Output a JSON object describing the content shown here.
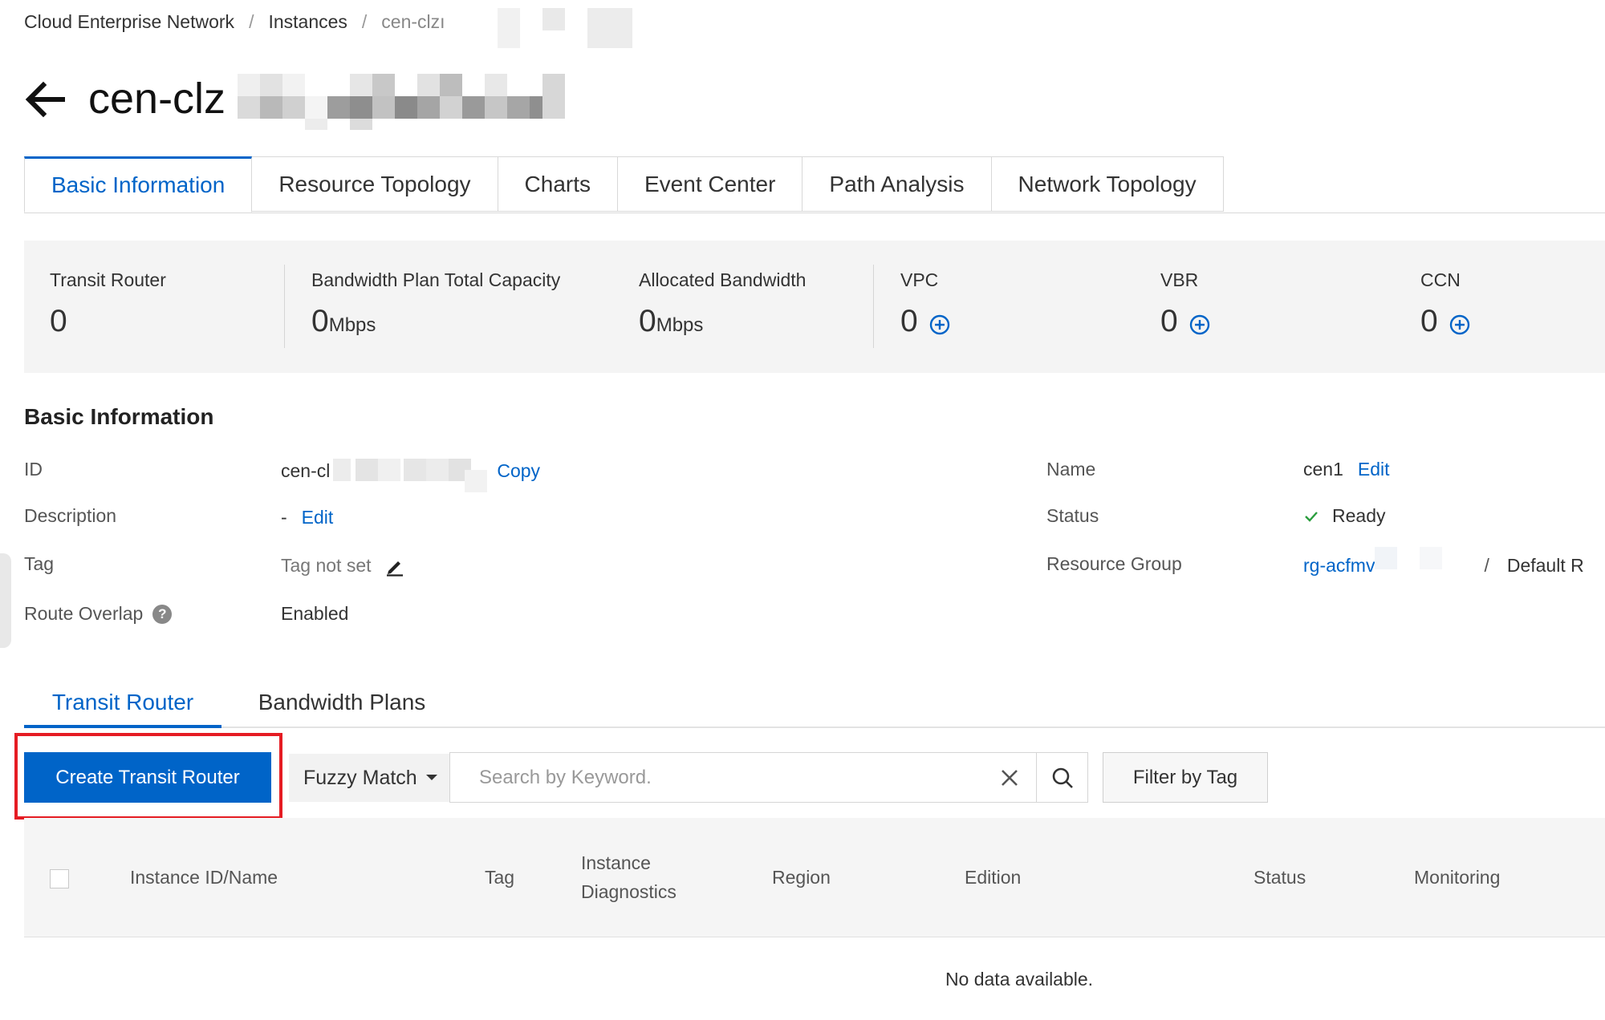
{
  "breadcrumb": {
    "items": [
      "Cloud Enterprise Network",
      "Instances",
      "cen-clzı"
    ],
    "separator": "/"
  },
  "header": {
    "title": "cen-clz"
  },
  "tabs": [
    "Basic Information",
    "Resource Topology",
    "Charts",
    "Event Center",
    "Path Analysis",
    "Network Topology"
  ],
  "stats": {
    "transit_router": {
      "label": "Transit Router",
      "value": "0"
    },
    "bandwidth_plan": {
      "label": "Bandwidth Plan Total Capacity",
      "value": "0",
      "unit": "Mbps"
    },
    "allocated": {
      "label": "Allocated Bandwidth",
      "value": "0",
      "unit": "Mbps"
    },
    "vpc": {
      "label": "VPC",
      "value": "0"
    },
    "vbr": {
      "label": "VBR",
      "value": "0"
    },
    "ccn": {
      "label": "CCN",
      "value": "0"
    }
  },
  "basic_info": {
    "title": "Basic Information",
    "id_label": "ID",
    "id_value": "cen-cl",
    "copy": "Copy",
    "description_label": "Description",
    "description_value": "-",
    "description_edit": "Edit",
    "tag_label": "Tag",
    "tag_value": "Tag not set",
    "route_overlap_label": "Route Overlap",
    "route_overlap_value": "Enabled",
    "name_label": "Name",
    "name_value": "cen1",
    "name_edit": "Edit",
    "status_label": "Status",
    "status_value": "Ready",
    "resource_group_label": "Resource Group",
    "resource_group_value": "rg-acfmv",
    "resource_group_sep": "/",
    "resource_group_name": "Default R"
  },
  "subtabs": [
    "Transit Router",
    "Bandwidth Plans"
  ],
  "toolbar": {
    "create_label": "Create Transit Router",
    "match_mode": "Fuzzy Match",
    "search_placeholder": "Search by Keyword.",
    "filter_label": "Filter by Tag"
  },
  "table": {
    "columns": [
      "Instance ID/Name",
      "Tag",
      "Instance",
      "Diagnostics",
      "Region",
      "Edition",
      "Status",
      "Monitoring"
    ],
    "empty": "No data available."
  },
  "colors": {
    "accent": "#0064c8",
    "highlight": "#e51c23",
    "success": "#2a9d3d"
  },
  "icons": [
    "back-arrow-icon",
    "plus-circle-icon",
    "edit-pencil-icon",
    "help-icon",
    "check-icon",
    "caret-down-icon",
    "close-icon",
    "search-icon"
  ]
}
